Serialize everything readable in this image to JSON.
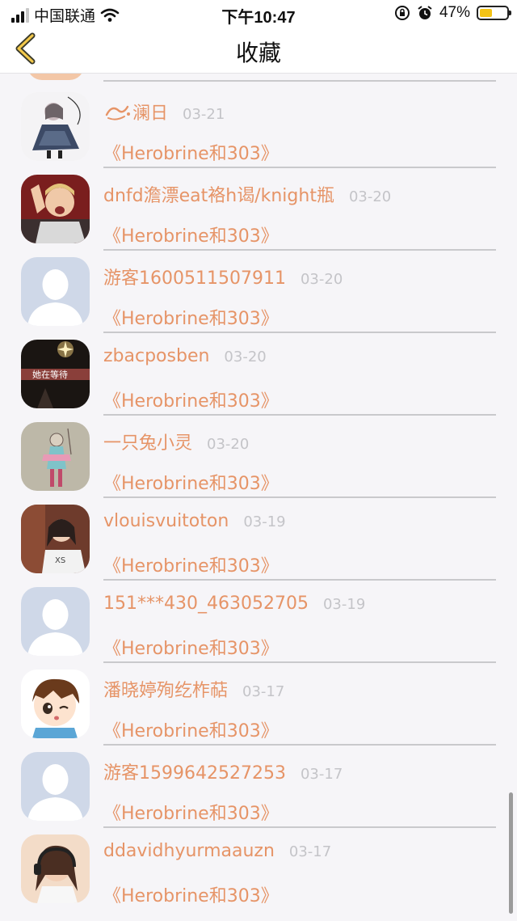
{
  "status_bar": {
    "carrier": "中国联通",
    "time": "下午10:47",
    "battery": "47%",
    "battery_level": 0.47
  },
  "nav": {
    "title": "收藏",
    "back_icon": "chevron-left-icon"
  },
  "colors": {
    "accent": "#e69467",
    "date": "#c4c4c8",
    "separator": "#c9c9cc",
    "battery_fill": "#f3c316"
  },
  "items": [
    {
      "name": "澜日",
      "name_prefix_icon": "swirl-icon",
      "date": "03-21",
      "work": "《Herobrine和303》",
      "avatar": "anime-girl-dark-dress"
    },
    {
      "name": "dnfd澹漂eat袼h谒/knight瓶",
      "date": "03-20",
      "work": "《Herobrine和303》",
      "avatar": "child-photo"
    },
    {
      "name": "游客1600511507911",
      "date": "03-20",
      "work": "《Herobrine和303》",
      "avatar": "default-avatar"
    },
    {
      "name": "zbacposben",
      "date": "03-20",
      "work": "《Herobrine和303》",
      "avatar": "dark-sparkle",
      "avatar_text": "她在等待"
    },
    {
      "name": "一只兔小灵",
      "date": "03-20",
      "work": "《Herobrine和303》",
      "avatar": "sketch-figure"
    },
    {
      "name": "vlouisvuitoton",
      "date": "03-19",
      "work": "《Herobrine和303》",
      "avatar": "girl-photo"
    },
    {
      "name": "151***430_463052705",
      "date": "03-19",
      "work": "《Herobrine和303》",
      "avatar": "default-avatar"
    },
    {
      "name": "潘晓婷殉纥柞萜",
      "date": "03-17",
      "work": "《Herobrine和303》",
      "avatar": "cartoon-boy"
    },
    {
      "name": "游客1599642527253",
      "date": "03-17",
      "work": "《Herobrine和303》",
      "avatar": "default-avatar"
    },
    {
      "name": "ddavidhyurmaauzn",
      "date": "03-17",
      "work": "《Herobrine和303》",
      "avatar": "girl-headphones"
    }
  ]
}
